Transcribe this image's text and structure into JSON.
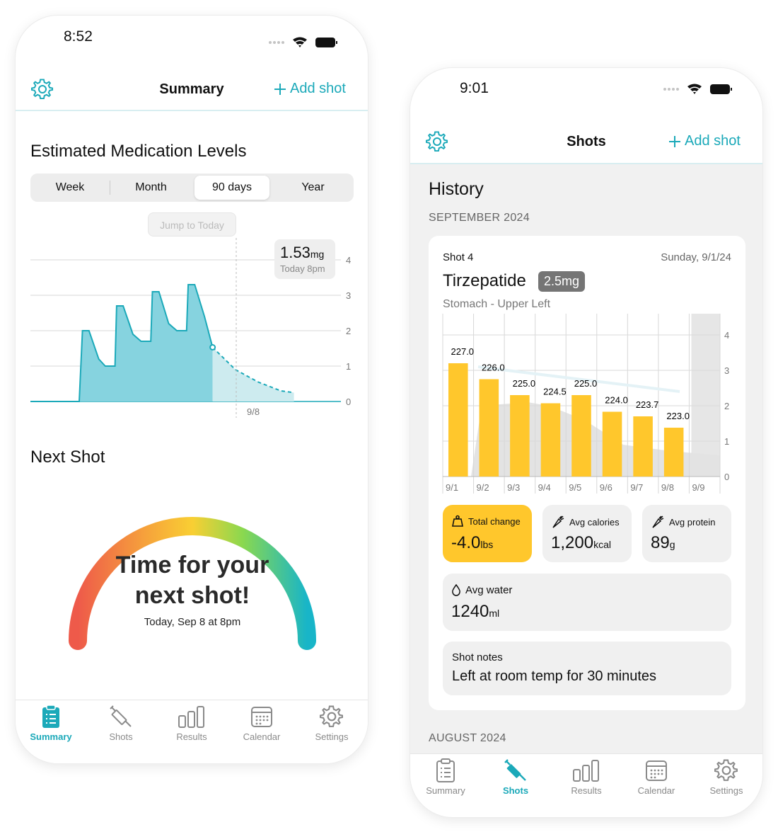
{
  "summary_screen": {
    "status_time": "8:52",
    "nav": {
      "title": "Summary",
      "add_shot": "Add shot"
    },
    "section_title": "Estimated Medication Levels",
    "segments": [
      "Week",
      "Month",
      "90 days",
      "Year"
    ],
    "selected_segment": "90 days",
    "jump_button": "Jump to Today",
    "tooltip": {
      "value": "1.53",
      "unit": "mg",
      "time": "Today 8pm"
    },
    "chart_data": {
      "type": "area",
      "y_ticks": [
        "4",
        "3",
        "2",
        "1",
        "0"
      ],
      "x_label": "9/8",
      "ylim": [
        0,
        4
      ],
      "points": [
        [
          0,
          0
        ],
        [
          1.5,
          0
        ],
        [
          1.6,
          2.0
        ],
        [
          1.8,
          2.0
        ],
        [
          2.1,
          1.2
        ],
        [
          2.3,
          1.0
        ],
        [
          2.6,
          1.0
        ],
        [
          2.65,
          2.7
        ],
        [
          2.85,
          2.7
        ],
        [
          3.15,
          1.9
        ],
        [
          3.4,
          1.7
        ],
        [
          3.7,
          1.7
        ],
        [
          3.75,
          3.1
        ],
        [
          3.95,
          3.1
        ],
        [
          4.25,
          2.2
        ],
        [
          4.5,
          2.0
        ],
        [
          4.8,
          2.0
        ],
        [
          4.85,
          3.3
        ],
        [
          5.05,
          3.3
        ],
        [
          5.35,
          2.4
        ],
        [
          5.6,
          1.53
        ]
      ],
      "forecast": [
        [
          5.6,
          1.53
        ],
        [
          6.3,
          0.9
        ],
        [
          7.0,
          0.55
        ],
        [
          7.7,
          0.3
        ],
        [
          8.1,
          0.25
        ]
      ]
    },
    "next_shot_title": "Next Shot",
    "gauge": {
      "line1": "Time for your",
      "line2": "next shot!",
      "when": "Today, Sep 8 at 8pm"
    },
    "tabs": [
      "Summary",
      "Shots",
      "Results",
      "Calendar",
      "Settings"
    ],
    "active_tab": "Summary"
  },
  "shots_screen": {
    "status_time": "9:01",
    "nav": {
      "title": "Shots",
      "add_shot": "Add shot"
    },
    "history_title": "History",
    "month_label": "SEPTEMBER 2024",
    "next_month_label": "AUGUST 2024",
    "card": {
      "shot_number": "Shot 4",
      "date": "Sunday, 9/1/24",
      "drug": "Tirzepatide",
      "dose": "2.5mg",
      "site": "Stomach - Upper Left"
    },
    "chart_data": {
      "type": "bar",
      "categories": [
        "9/1",
        "9/2",
        "9/3",
        "9/4",
        "9/5",
        "9/6",
        "9/7",
        "9/8",
        "9/9"
      ],
      "weights": [
        227.0,
        226.0,
        225.0,
        224.5,
        225.0,
        224.0,
        223.7,
        223.0
      ],
      "weight_labels": [
        "227.0",
        "226.0",
        "225.0",
        "224.5",
        "225.0",
        "224.0",
        "223.7",
        "223.0"
      ],
      "y_ticks": [
        "4",
        "3",
        "2",
        "1",
        "0"
      ],
      "ylim": [
        0,
        4
      ],
      "bar_levels": [
        3.2,
        2.75,
        2.3,
        2.07,
        2.3,
        1.83,
        1.7,
        1.38
      ]
    },
    "stats": {
      "total_change": {
        "label": "Total change",
        "value": "-4.0",
        "unit": "lbs"
      },
      "avg_calories": {
        "label": "Avg calories",
        "value": "1,200",
        "unit": "kcal"
      },
      "avg_protein": {
        "label": "Avg protein",
        "value": "89",
        "unit": "g"
      },
      "avg_water": {
        "label": "Avg water",
        "value": "1240",
        "unit": "ml"
      }
    },
    "notes": {
      "label": "Shot notes",
      "text": "Left at room temp for 30 minutes"
    },
    "tabs": [
      "Summary",
      "Shots",
      "Results",
      "Calendar",
      "Settings"
    ],
    "active_tab": "Shots",
    "accent": "#1ba9b9",
    "bar_color": "#ffc72c"
  }
}
